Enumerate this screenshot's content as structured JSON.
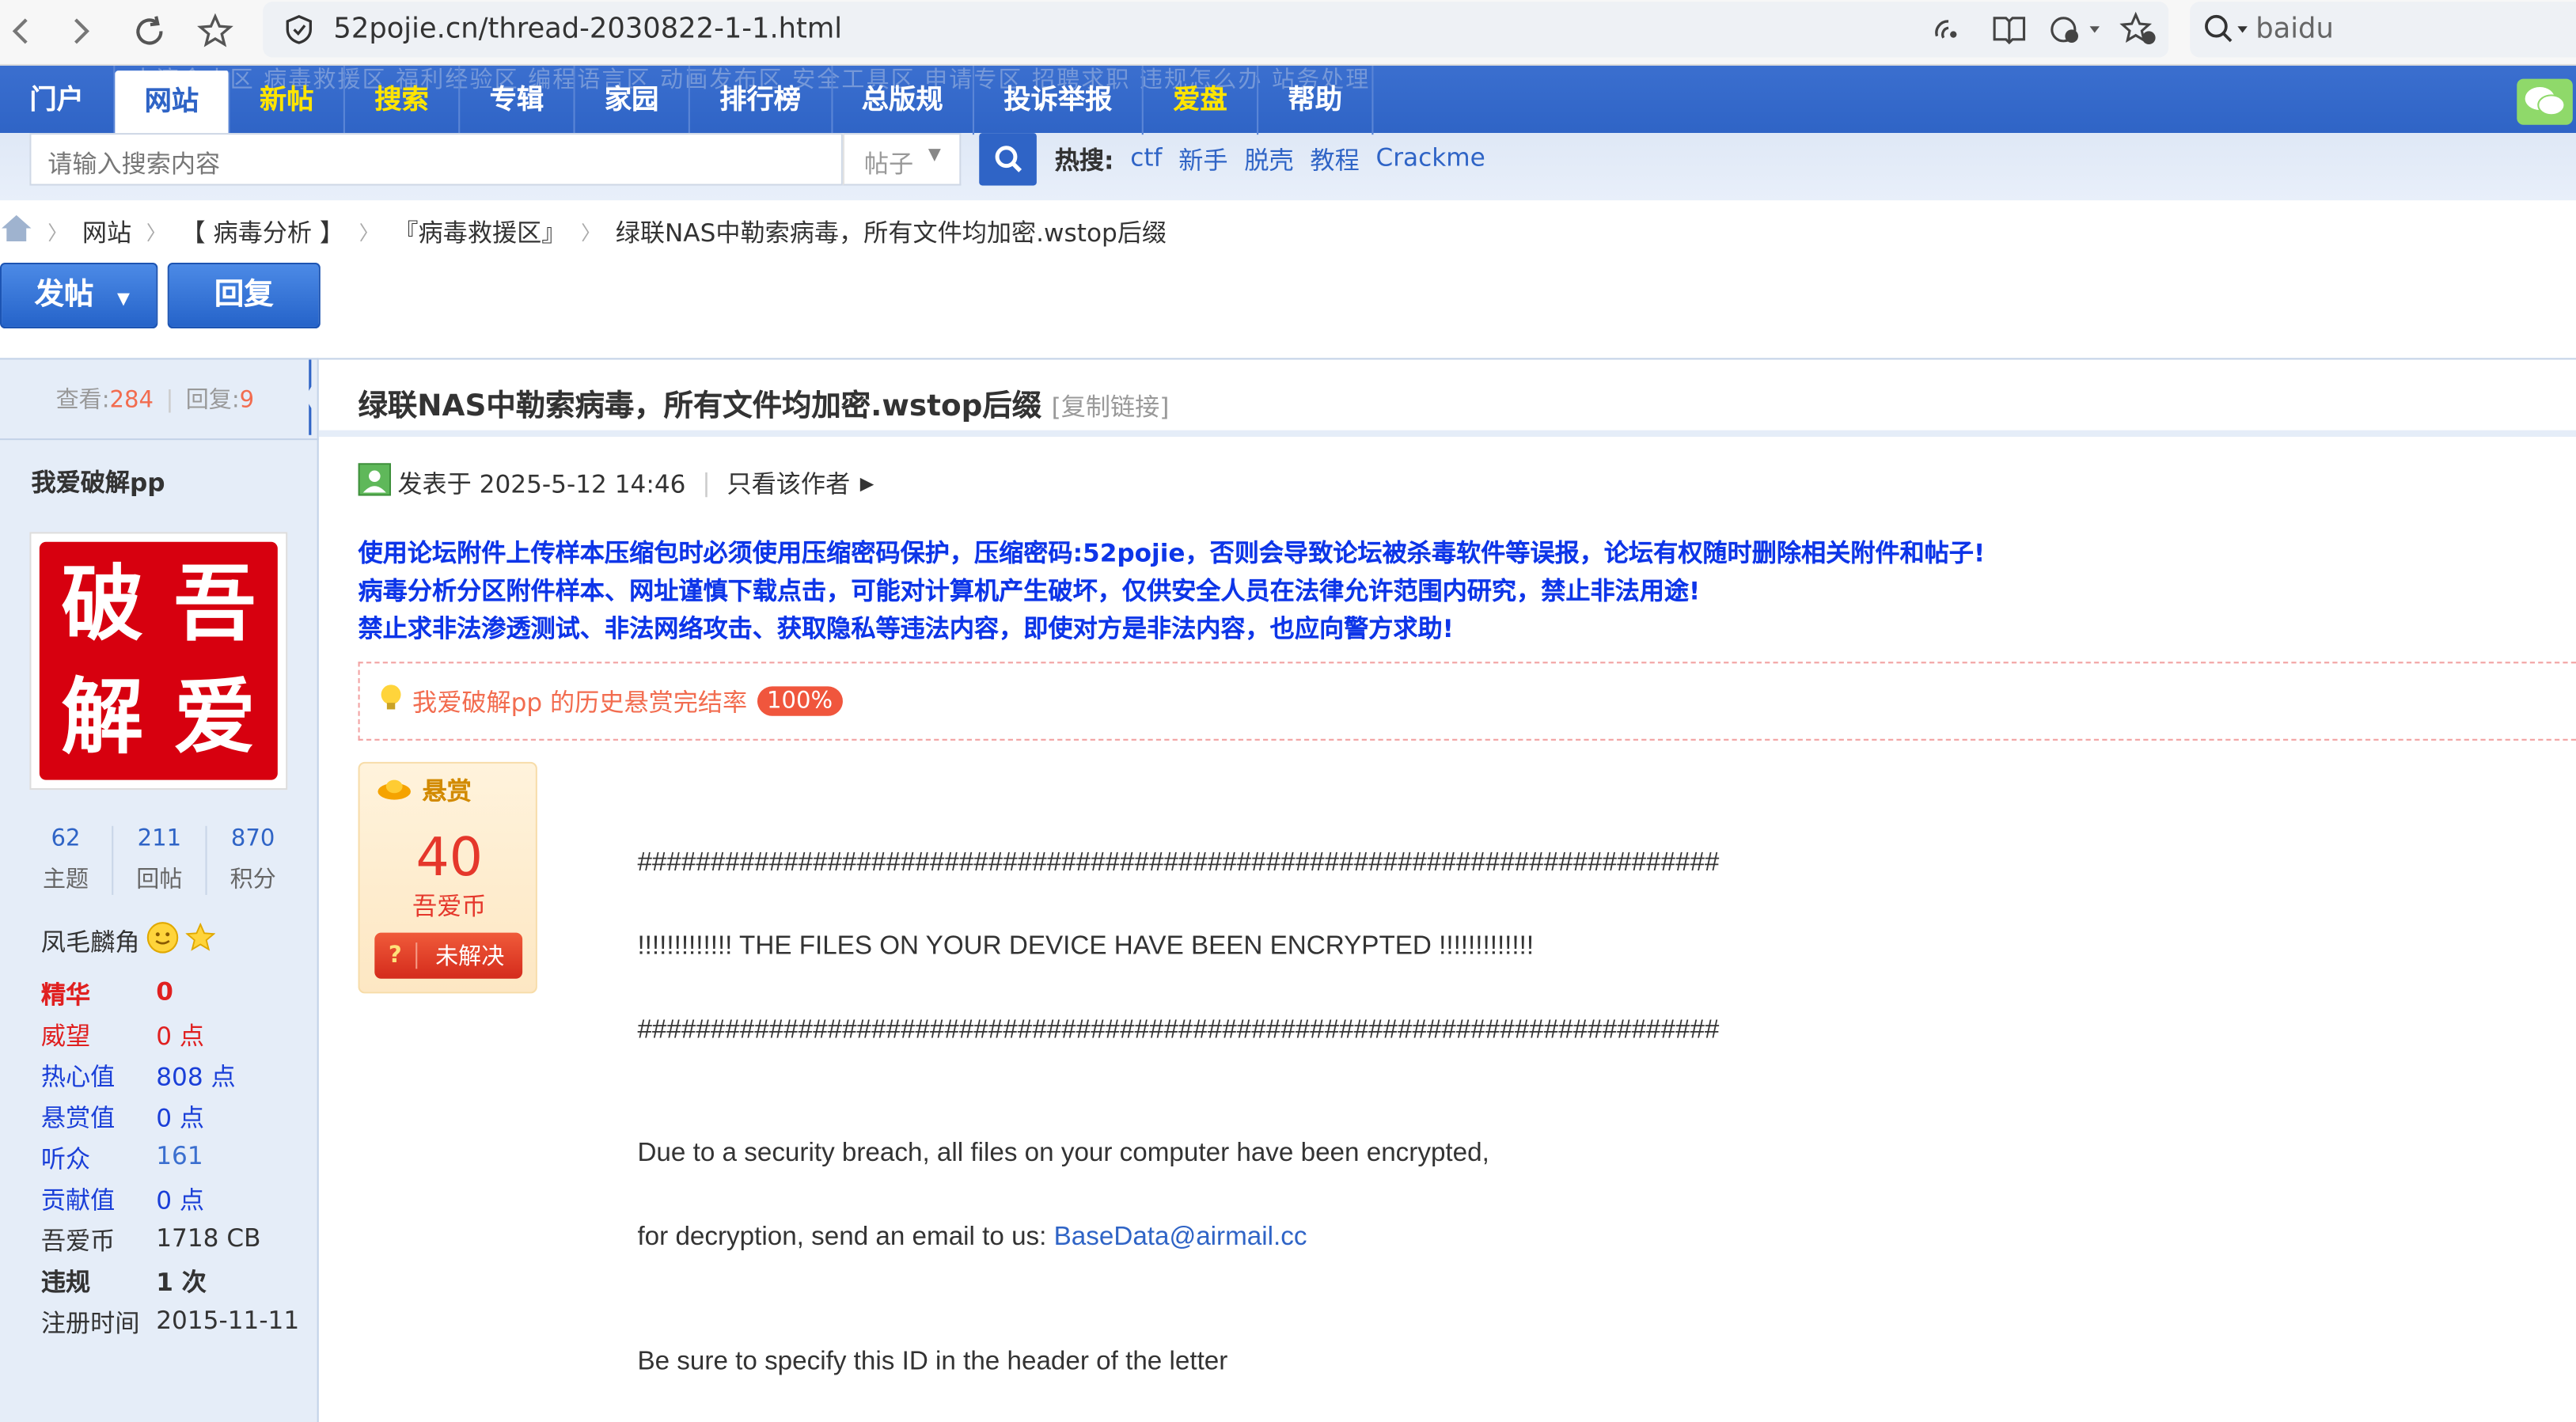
{
  "browser": {
    "url": "52pojie.cn/thread-2030822-1-1.html",
    "search_text": "baidu"
  },
  "header": {
    "ghost_text": "水滴金山区  病毒救援区  福利经验区        编程语言区  动画发布区  安全工具区        申请专区  招聘求职  违规怎么办         站务处理",
    "nav": [
      {
        "label": "门户"
      },
      {
        "label": "网站"
      },
      {
        "label": "新帖"
      },
      {
        "label": "搜索"
      },
      {
        "label": "专辑"
      },
      {
        "label": "家园"
      },
      {
        "label": "排行榜"
      },
      {
        "label": "总版规"
      },
      {
        "label": "投诉举报"
      },
      {
        "label": "爱盘"
      },
      {
        "label": "帮助"
      }
    ],
    "search_placeholder": "请输入搜索内容",
    "search_scope": "帖子",
    "hot_label": "热搜:",
    "hot_terms": [
      "ctf",
      "新手",
      "脱壳",
      "教程",
      "Crackme"
    ]
  },
  "breadcrumb": [
    "网站",
    "【 病毒分析 】",
    "『病毒救援区』",
    "绿联NAS中勒索病毒，所有文件均加密.wstop后缀"
  ],
  "buttons": {
    "post": "发帖",
    "reply": "回复"
  },
  "stats": {
    "views_label": "查看:",
    "views": "284",
    "replies_label": "回复:",
    "replies": "9"
  },
  "thread": {
    "title": "绿联NAS中勒索病毒，所有文件均加密.wstop后缀",
    "copy_link": "[复制链接]",
    "posted": "发表于 2025-5-12 14:46",
    "only_author": "只看该作者",
    "warning": [
      "使用论坛附件上传样本压缩包时必须使用压缩密码保护，压缩密码:52pojie，否则会导致论坛被杀毒软件等误报，论坛有权随时删除相关附件和帖子!",
      "病毒分析分区附件样本、网址谨慎下载点击，可能对计算机产生破坏，仅供安全人员在法律允许范围内研究，禁止非法用途!",
      "禁止求非法渗透测试、非法网络攻击、获取隐私等违法内容，即使对方是非法内容，也应向警方求助!"
    ],
    "reward_history": "我爱破解pp 的历史悬赏完结率",
    "reward_pct": "100%",
    "reward": {
      "label": "悬赏",
      "amount": "40",
      "currency": "吾爱币",
      "status": "未解决"
    },
    "body": {
      "hash_line": "##########################################################################",
      "headline": "!!!!!!!!!!!!! THE FILES ON YOUR DEVICE HAVE BEEN ENCRYPTED !!!!!!!!!!!!!",
      "line1": "Due to a security breach, all files on your computer have been encrypted,",
      "line2_prefix": "for decryption, send an email to us: ",
      "email": "BaseData@airmail.cc",
      "line3": "Be sure to specify this ID in the header of the letter"
    }
  },
  "user": {
    "name": "我爱破解pp",
    "avatar_chars": [
      "破",
      "吾",
      "解",
      "爱"
    ],
    "topics": "62",
    "topics_label": "主题",
    "posts": "211",
    "posts_label": "回帖",
    "points": "870",
    "points_label": "积分",
    "rank": "凤毛麟角",
    "info": [
      {
        "k": "精华",
        "v": "0",
        "kc": "#e02020",
        "vc": "#e02020",
        "bold": true
      },
      {
        "k": "威望",
        "v": "0 点",
        "kc": "#e02020",
        "vc": "#e02020",
        "bold": false
      },
      {
        "k": "热心值",
        "v": "808 点",
        "kc": "#1a3fd8",
        "vc": "#1a3fd8",
        "bold": false
      },
      {
        "k": "悬赏值",
        "v": "0 点",
        "kc": "#1a3fd8",
        "vc": "#1a3fd8",
        "bold": false
      },
      {
        "k": "听众",
        "v": "161",
        "kc": "#1a3fd8",
        "vc": "#3b6fcf",
        "bold": false
      },
      {
        "k": "贡献值",
        "v": "0 点",
        "kc": "#1a3fd8",
        "vc": "#1a3fd8",
        "bold": false
      },
      {
        "k": "吾爱币",
        "v": "1718 CB",
        "kc": "#333333",
        "vc": "#333333",
        "bold": false
      },
      {
        "k": "违规",
        "v": "1 次",
        "kc": "#333333",
        "vc": "#333333",
        "bold": true
      },
      {
        "k": "注册时间",
        "v": "2015-11-11",
        "kc": "#333333",
        "vc": "#333333",
        "bold": false
      }
    ]
  }
}
